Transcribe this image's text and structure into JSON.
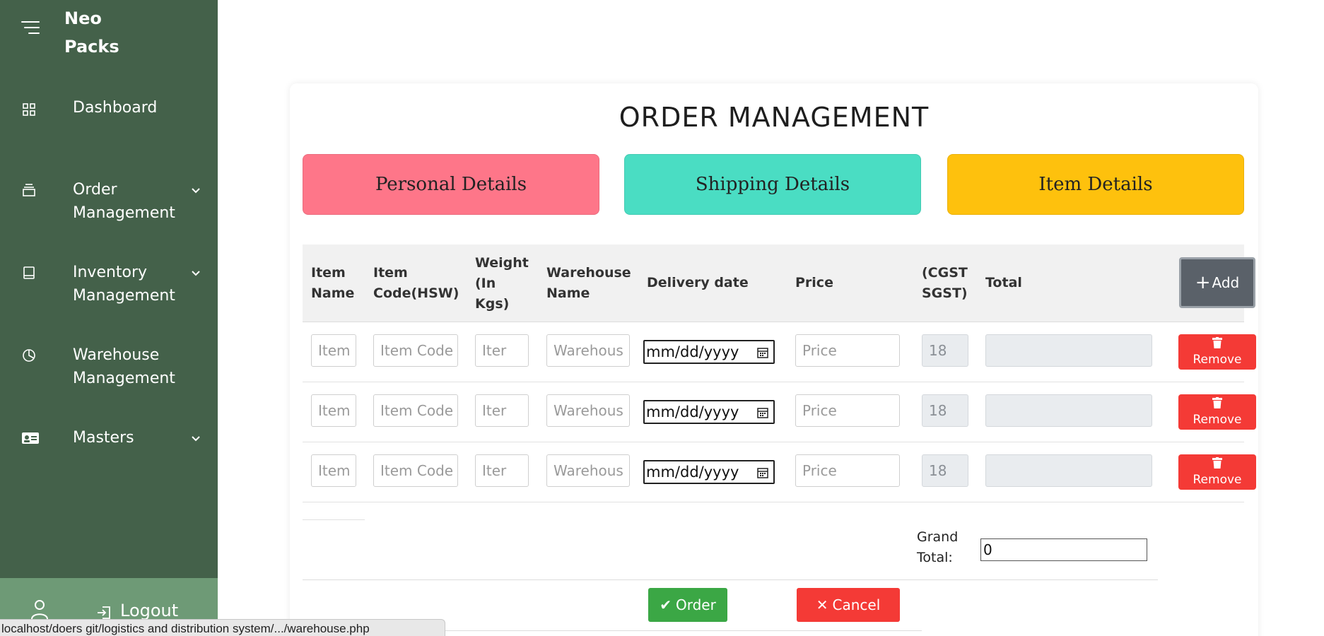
{
  "brand": {
    "name": "Neo Packs"
  },
  "sidebar": {
    "items": [
      {
        "label": "Dashboard",
        "icon": "grid-icon",
        "has_submenu": false
      },
      {
        "label": "Order Management",
        "icon": "layers-icon",
        "has_submenu": true
      },
      {
        "label": "Inventory Management",
        "icon": "book-icon",
        "has_submenu": true
      },
      {
        "label": "Warehouse Management",
        "icon": "pie-chart-icon",
        "has_submenu": false
      },
      {
        "label": "Masters",
        "icon": "id-card-icon",
        "has_submenu": true
      }
    ],
    "logout_label": "Logout"
  },
  "status_bar": {
    "url": "localhost/doers git/logistics and distribution system/.../warehouse.php"
  },
  "page": {
    "title": "ORDER MANAGEMENT",
    "steps": [
      "Personal Details",
      "Shipping Details",
      "Item Details"
    ]
  },
  "table": {
    "headers": {
      "item_name": "Item Name",
      "item_code": "Item Code(HSW)",
      "weight": "Weight (In Kgs)",
      "warehouse": "Warehouse Name",
      "delivery_date": "Delivery date",
      "price": "Price",
      "tax": "(CGST SGST)",
      "total": "Total"
    },
    "add_label": "Add",
    "placeholders": {
      "item_name": "Item",
      "item_code": "Item Code",
      "weight": "Iter",
      "warehouse": "Warehous",
      "delivery_date": "mm/dd/yyyy",
      "price": "Price"
    },
    "rows": [
      {
        "tax": "18",
        "total": "",
        "remove_label": "Remove"
      },
      {
        "tax": "18",
        "total": "",
        "remove_label": "Remove"
      },
      {
        "tax": "18",
        "total": "",
        "remove_label": "Remove"
      }
    ]
  },
  "summary": {
    "grand_total_label": "Grand Total:",
    "grand_total_value": "0"
  },
  "actions": {
    "order_label": "Order",
    "cancel_label": "Cancel"
  },
  "colors": {
    "sidebar": "#44614a",
    "logout_bar": "#6e9a76",
    "personal": "#fe7689",
    "shipping": "#4addc3",
    "item": "#fec10d",
    "danger": "#f43a36",
    "success": "#3ba745",
    "add_button": "#5a6169"
  }
}
